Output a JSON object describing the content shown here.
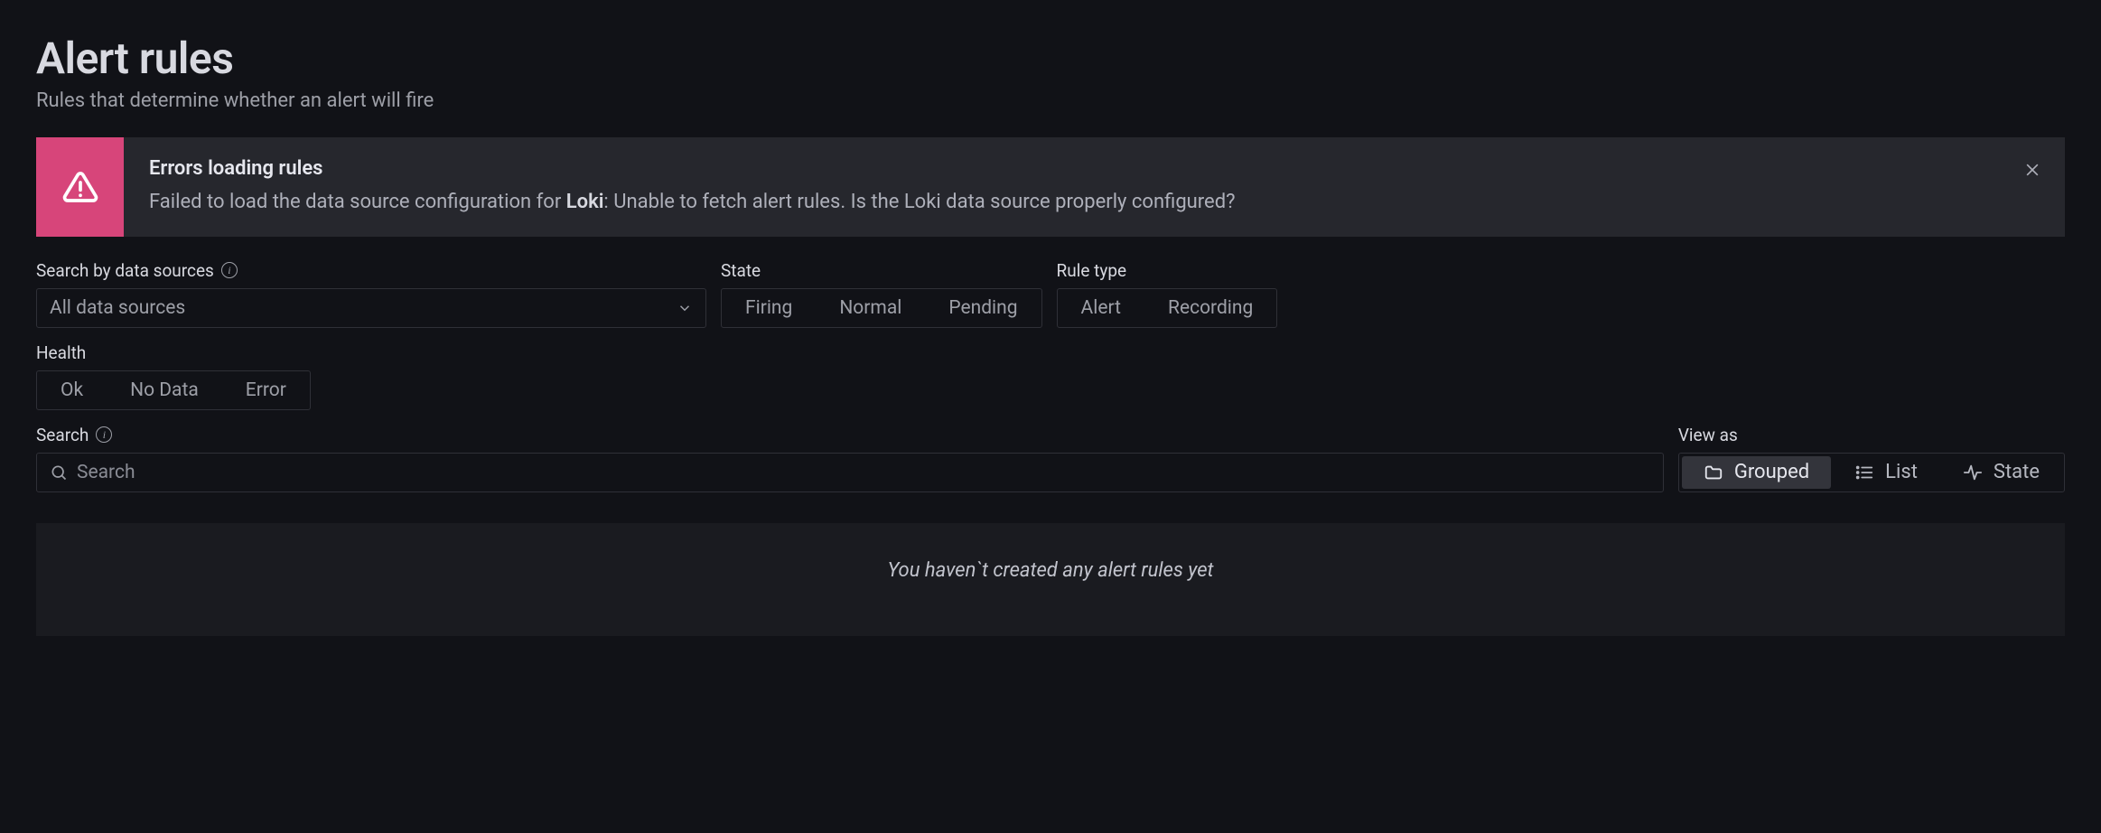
{
  "header": {
    "title": "Alert rules",
    "subtitle": "Rules that determine whether an alert will fire"
  },
  "alert": {
    "title": "Errors loading rules",
    "msg_prefix": "Failed to load the data source configuration for ",
    "msg_bold": "Loki",
    "msg_suffix": ": Unable to fetch alert rules. Is the Loki data source properly configured?"
  },
  "filters": {
    "datasources": {
      "label": "Search by data sources",
      "selected": "All data sources"
    },
    "state": {
      "label": "State",
      "options": [
        "Firing",
        "Normal",
        "Pending"
      ]
    },
    "rule_type": {
      "label": "Rule type",
      "options": [
        "Alert",
        "Recording"
      ]
    },
    "health": {
      "label": "Health",
      "options": [
        "Ok",
        "No Data",
        "Error"
      ]
    }
  },
  "search": {
    "label": "Search",
    "placeholder": "Search"
  },
  "viewas": {
    "label": "View as",
    "options": [
      "Grouped",
      "List",
      "State"
    ],
    "active": "Grouped"
  },
  "empty": "You haven`t created any alert rules yet"
}
